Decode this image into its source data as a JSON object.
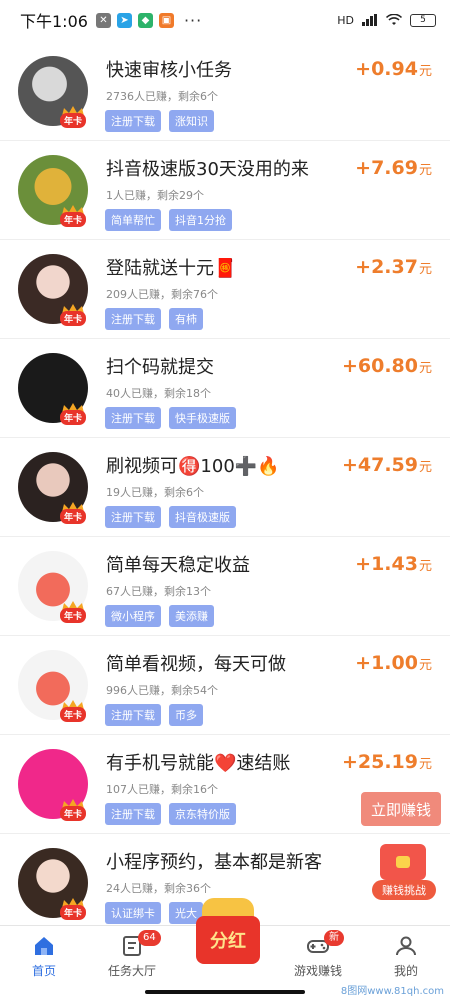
{
  "status_bar": {
    "time": "下午1:06",
    "dots": "···",
    "battery": "5",
    "network": "HD"
  },
  "colors": {
    "accent": "#2f6fe0",
    "reward": "#ee7d2c",
    "tag_bg": "#8fa8f0",
    "red": "#e8342a"
  },
  "badge_label": "年卡",
  "reward_unit": "元",
  "tasks": [
    {
      "title": "快速审核小任务",
      "meta": "2736人已赚，剩余6个",
      "tags": [
        "注册下载",
        "涨知识"
      ],
      "reward": "+0.94"
    },
    {
      "title": "抖音极速版30天没用的来",
      "meta": "1人已赚，剩余29个",
      "tags": [
        "简单帮忙",
        "抖音1分抢"
      ],
      "reward": "+7.69"
    },
    {
      "title": "登陆就送十元🧧",
      "meta": "209人已赚，剩余76个",
      "tags": [
        "注册下载",
        "有柿"
      ],
      "reward": "+2.37"
    },
    {
      "title": "扫个码就提交",
      "meta": "40人已赚，剩余18个",
      "tags": [
        "注册下载",
        "快手极速版"
      ],
      "reward": "+60.80"
    },
    {
      "title": "刷视频可🉐100➕🔥",
      "meta": "19人已赚，剩余6个",
      "tags": [
        "注册下载",
        "抖音极速版"
      ],
      "reward": "+47.59"
    },
    {
      "title": "简单每天稳定收益",
      "meta": "67人已赚，剩余13个",
      "tags": [
        "微小程序",
        "美添赚"
      ],
      "reward": "+1.43"
    },
    {
      "title": "简单看视频，每天可做",
      "meta": "996人已赚，剩余54个",
      "tags": [
        "注册下载",
        "币多"
      ],
      "reward": "+1.00"
    },
    {
      "title": "有手机号就能❤️速结账",
      "meta": "107人已赚，剩余16个",
      "tags": [
        "注册下载",
        "京东特价版"
      ],
      "reward": "+25.19"
    },
    {
      "title": "小程序预约，基本都是新客",
      "meta": "24人已赚，剩余36个",
      "tags": [
        "认证绑卡",
        "光大"
      ],
      "reward": ""
    }
  ],
  "floating": {
    "earn_button": "立即赚钱",
    "challenge_label": "赚钱挑战"
  },
  "tabbar": {
    "home": "首页",
    "tasks": "任务大厅",
    "tasks_badge": "64",
    "fenhong": "分红",
    "games": "游戏赚钱",
    "games_badge": "新",
    "mine": "我的"
  },
  "watermark": "8图网www.81qh.com"
}
